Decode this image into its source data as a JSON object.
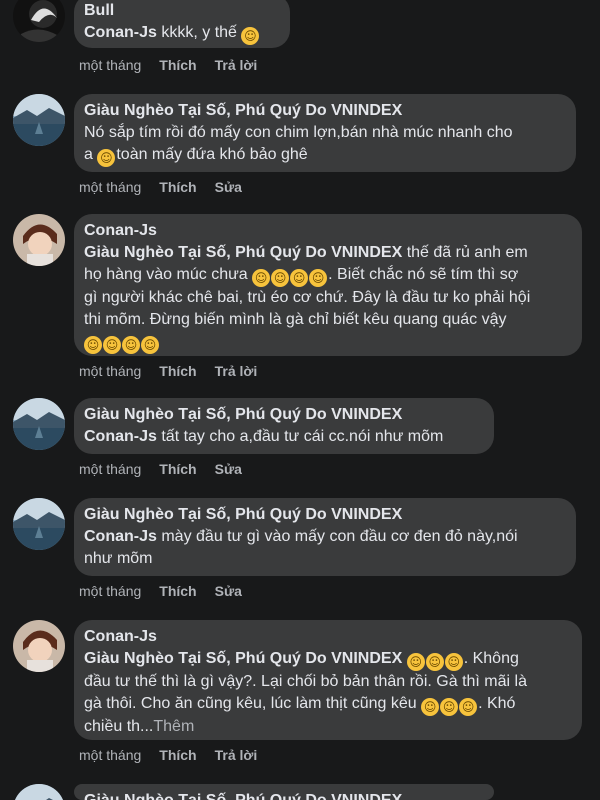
{
  "comments": [
    {
      "author": "Bull",
      "mention": "Conan-Js",
      "text": " kkkk, y thế ",
      "time": "một tháng",
      "like": "Thích",
      "reply_or_edit": "Trả lời"
    },
    {
      "author": "Giàu Nghèo Tại Số, Phú Quý Do VNINDEX",
      "line1": "Nó sắp tím rồi đó mấy con chim lợn,bán nhà múc nhanh cho",
      "line2a": "a ",
      "line2b": "toàn mấy đứa khó bảo ghê",
      "time": "một tháng",
      "like": "Thích",
      "reply_or_edit": "Sửa"
    },
    {
      "author": "Conan-Js",
      "mention": "Giàu Nghèo Tại Số, Phú Quý Do VNINDEX",
      "line1": " thế đã rủ anh em",
      "line2": "họ hàng vào múc chưa ",
      "line2b": ". Biết chắc nó sẽ tím thì sợ",
      "line3": "gì người khác chê bai, trù éo cơ chứ. Đây là đầu tư ko phải hội",
      "line4": "thi mõm. Đừng biến mình là gà chỉ biết kêu quang quác vậy",
      "time": "một tháng",
      "like": "Thích",
      "reply_or_edit": "Trả lời"
    },
    {
      "author": "Giàu Nghèo Tại Số, Phú Quý Do VNINDEX",
      "mention": "Conan-Js",
      "text": " tất tay cho a,đầu tư cái cc.nói như mõm",
      "time": "một tháng",
      "like": "Thích",
      "reply_or_edit": "Sửa"
    },
    {
      "author": "Giàu Nghèo Tại Số, Phú Quý Do VNINDEX",
      "mention": "Conan-Js",
      "line1": " mày đầu tư gì vào mấy con đầu cơ đen đỏ này,nói",
      "line2": "như mõm",
      "time": "một tháng",
      "like": "Thích",
      "reply_or_edit": "Sửa"
    },
    {
      "author": "Conan-Js",
      "mention": "Giàu Nghèo Tại Số, Phú Quý Do VNINDEX",
      "line1b": ". Không",
      "line2": "đầu tư thế thì là gì vậy?. Lại chối bỏ bản thân rồi. Gà thì mãi là",
      "line3": "gà thôi. Cho ăn cũng kêu, lúc làm thịt cũng kêu ",
      "line3b": ". Khó",
      "line4": "chiều th...",
      "more": "Thêm",
      "time": "một tháng",
      "like": "Thích",
      "reply_or_edit": "Trả lời"
    },
    {
      "author": "Giàu Nghèo Tại Số, Phú Quý Do VNINDEX"
    }
  ],
  "icons": {
    "grin": "grinning-emoji",
    "tongue": "winking-tongue-emoji",
    "rofl": "rolling-laughing-emoji"
  },
  "colors": {
    "background": "#18191a",
    "bubble": "#3a3b3c",
    "text": "#e4e6eb",
    "meta": "#b0b3b8"
  }
}
